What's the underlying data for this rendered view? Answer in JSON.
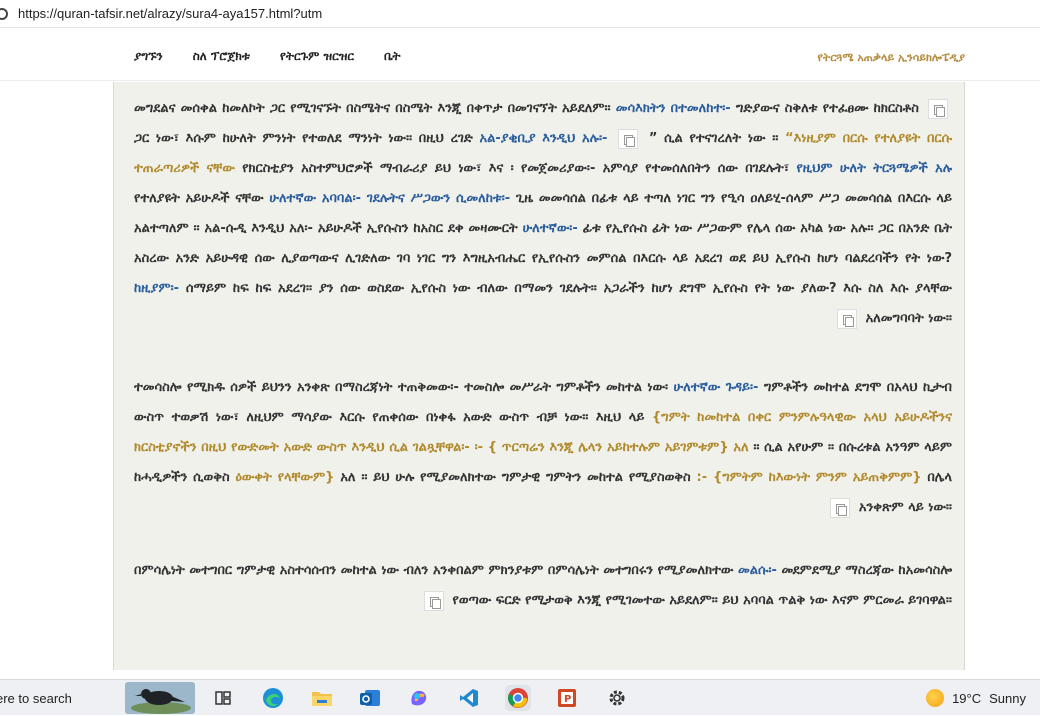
{
  "browser": {
    "url": "https://quran-tafsir.net/alrazy/sura4-aya157.html?utm"
  },
  "header": {
    "nav": [
      "ያግኙን",
      "ስለ ፕሮጀክቱ",
      "የትርጉም ዝርዝር",
      "ቤት"
    ],
    "brand": "የትርጓሜ አጠቃላይ ኢንሳይክሎፔዲያ"
  },
  "article": {
    "p1": {
      "s1": "መግደልና መሰቀል ከመለኮት ጋር የሚገናኙት በስሜትና በስሜት እንጂ በቀጥታ በመገናኘት አይደለም። ",
      "s2": "መሳእክትን በተመለከተ፡-",
      "s3": " ግድያውና ስቅለቱ የተፈፀሙ ከክርስቶስ ጋር ነው፣ እሱም ከሁለት ምንነት የተወለደ ማንነት ነው። በዚህ ረገድ",
      "s4": "አል-ያቂቢያ እንዲህ አሉ፡-",
      "s5": " ” ሲል የተናገረለት ነው ። ",
      "s6": "“እነዚያም በርሱ የተለያዩት በርሱ ተጠራጣሪዎች ናቸው",
      "s7": "የክርስቲያን አስተምህሮዎች ማብራሪያ ይህ ነው፣ እና ፡ የመጀመሪያው፡- አምሳያ የተመሰለበትን ሰው በገደሉት፣ ",
      "s8": "የዚህም ሁለት ትርጓሜዎች አሉ",
      "s9": " የተለያዩት አይሁዶች ናቸው ",
      "s10": "ሁለተኛው አባባል፡- ገደሉትና ሥጋውን ሲመለከቱ፡-",
      "s11": "ጊዜ መመሳሰል በፊቱ ላይ ተጣለ ነገር ግን የዒሳ ዐለይሂ-ሰላም ሥጋ መመሳሰል በእርሱ ላይ አልተጣለም ። አል-ሱዲ እንዲህ አለ፡- አይሁዶች ኢየሱስን ከአስር ደቀ መዛሙርት",
      "s12": "ሁለተኛው፡-",
      "s13": "ፊቱ የኢየሱስ ፊት ነው ሥጋውም የሌላ ሰው አካል ነው አሉ። ጋር በአንድ ቤት አስረው አንድ አይሁዳዊ ሰው ሊያወጣውና ሊገድለው ገባ ነገር ግን እግዚአብሔር የኢየሱስን መምሰል በእርሱ ላይ አደረገ ወደ ይህ ኢየሱስ ከሆነ ባልደረባችን የት ነው?",
      "s14": "ከዚያም፡-",
      "s15": "ሰማይም ከፍ ከፍ አደረገ። ያን ሰው ወስደው ኢየሱስ ነው ብለው በማመን ገደሉት። አጋራችን ከሆነ ደግሞ ኢየሱስ የት ነው ያለው? እሱ ስለ እሱ ያላቸው አለመግባባት ነው።"
    },
    "p2": {
      "s1": "ተመሳስሎ የሚክዱ ሰዎች ይህንን አንቀጽ በማስረጃነት ተጠቅመው፡- ተመስሎ መሥራት ግምቶችን መከተል ነው፡",
      "s2": "ሁለተኛው ጉዳይ፡-",
      "s3": " ግምቶችን መከተል ደግሞ በአላህ ኪታብ ውስጥ ተወቃሽ ነው፣ ለዚህም ማሳያው እርሱ የጠቀሰው በነቀፋ አውድ ውስጥ ብቻ ነው። እዚህ ላይ ",
      "s4": "{ግምት ከመከተል በቀር ምንምሉዓላዊው አላህ አይሁዶችንና ክርስቲያኖችን በዚህ የውድመት አውድ ውስጥ እንዲህ ሲል ገልጿቸዋል፡- ፡- { ጥርጣሬን እንጂ ሌላን አይከተሉም አይገምቱም} አለ",
      "s5": "። ሲል አየሁም ። በሱረቱል አንዓም ላይም ከሓዲዎችን ሲወቅስ ",
      "s6": "ዕውቀት የላቸውም}",
      "s7": " አለ ። ይህ ሁሉ የሚያመለክተው ግምታዊ ግምትን መከተል የሚያስወቅስ",
      "s8": ":- {ግምትም ከእውነት ምንም አይጠቅምም}",
      "s9": "በሌላ አንቀጽም ላይ ነው።"
    },
    "p3": {
      "s1": "በምሳሌነት መተግበር ግምታዊ አስተሳሰብን መከተል ነው ብለን አንቀበልም ምክንያቱም በምሳሌነት መተግበሩን የሚያመለክተው",
      "s2": "መልሱ፡-",
      "s3": " መደምደሚያ ማስረጃው ከአመሳስሎ የወጣው ፍርድ የሚታወቅ እንጂ የሚገመተው አይደለም። ይህ አባባል ጥልቅ ነው እናም ምርመራ ይገባዋል።"
    }
  },
  "taskbar": {
    "search_text": "ere to search",
    "weather_temp": "19°C",
    "weather_desc": "Sunny"
  },
  "colors": {
    "blue_link": "#2a5d9c",
    "gold_quote": "#b08a2c",
    "brand": "#b58b3d",
    "article_bg": "#f1f1ec"
  }
}
